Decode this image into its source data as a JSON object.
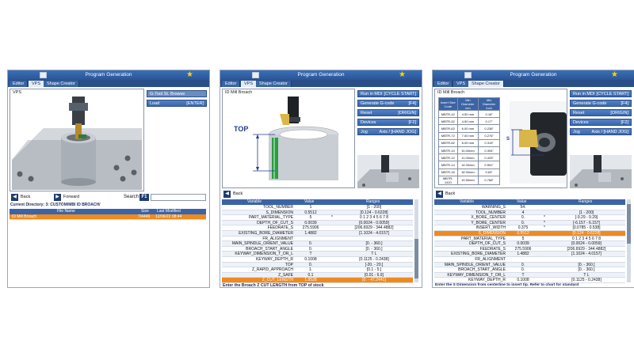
{
  "vps_panel": {
    "title": "Program Generation",
    "tabs": [
      "Editor",
      "VPS",
      "Shape Creator"
    ],
    "group_label": "VPS",
    "side_buttons": [
      {
        "label": "G-Tool St. Browse",
        "key": ""
      },
      {
        "label": "Load",
        "key": "[ENTER]"
      }
    ],
    "back_label": "Back",
    "forward_label": "Forward",
    "search_label": "Search",
    "search_key": "F1",
    "current_directory": "Current Directory: 3: CUSTOM/MBI ID BROACH/",
    "columns": [
      "File Name",
      "Size",
      "Last Modified"
    ],
    "files": [
      {
        "name": "ID Mill Broach",
        "size": "7/4449",
        "modified": "12/06/22 08:44"
      }
    ]
  },
  "broach_panel": {
    "title": "Program Generation",
    "tabs": [
      "Editor",
      "VPS",
      "Shape Creator"
    ],
    "group_label": "ID Mill Broach",
    "diagram_label": "TOP",
    "side_buttons": [
      {
        "label": "Run in MDI",
        "key": "[CYCLE START]"
      },
      {
        "label": "Generate G-code",
        "key": "[F4]"
      },
      {
        "label": "Reset",
        "key": "[ORIGIN]"
      },
      {
        "label": "Devices",
        "key": "[F2]"
      },
      {
        "label": "Jog",
        "key": "Axis / [HAND JOG]"
      }
    ],
    "back_label": "Back",
    "columns": [
      "Variable",
      "Value",
      "Ranges"
    ],
    "rows": [
      {
        "variable": "TOOL_NUMBER",
        "value": "1",
        "range": "[1 - 200]",
        "mark": ""
      },
      {
        "variable": "S_DIMENSION",
        "value": "0.5512",
        "range": "[0.124 - 0.6228]",
        "mark": ""
      },
      {
        "variable": "PART_MATERIAL_TYPE",
        "value": "5",
        "range": "0 1 2 3 4 5 6 7 8",
        "mark": "*"
      },
      {
        "variable": "DEPTH_OF_CUT_S",
        "value": "0.0039",
        "range": "[0.0024 - 0.0059]",
        "mark": ""
      },
      {
        "variable": "FEEDRATE_S",
        "value": "275.5906",
        "range": "[206.6929 - 344.4882]",
        "mark": ""
      },
      {
        "variable": "EXISTING_BORE_DIAMETER",
        "value": "1.4882",
        "range": "[1.1024 - 4.0157]",
        "mark": ""
      },
      {
        "variable": "FR_ALIGNMENT",
        "value": "",
        "range": "",
        "mark": ""
      },
      {
        "variable": "MAIN_SPINDLE_ORIENT_VALUE",
        "value": "0.",
        "range": "[0. - 360.]",
        "mark": ""
      },
      {
        "variable": "BROACH_START_ANGLE",
        "value": "0.",
        "range": "[0. - 360.]",
        "mark": ""
      },
      {
        "variable": "KEYWAY_DIMENSION_T_OR_L",
        "value": "T",
        "range": "T L",
        "mark": ""
      },
      {
        "variable": "KEYWAY_DEPTH_R",
        "value": "0.1008",
        "range": "[0.1125 - 0.2438]",
        "mark": ""
      },
      {
        "variable": "TOP",
        "value": "0.",
        "range": "[-20. - 20.]",
        "mark": ""
      },
      {
        "variable": "Z_RAPID_APPROACH",
        "value": "1.",
        "range": "[0.1 - 5.]",
        "mark": ""
      },
      {
        "variable": "Z_SAFE",
        "value": "0.1",
        "range": "[0.01 - 6.9]",
        "mark": ""
      },
      {
        "variable": "Z_CUT_LENGTH",
        "value": "1.9528",
        "range": "[0. - 47.2441]",
        "mark": ""
      }
    ],
    "status": "Enter the Broach Z CUT LENGTH from TOP of stock"
  },
  "s_panel": {
    "title": "Program Generation",
    "tabs": [
      "Editor",
      "VPS",
      "Shape Creator"
    ],
    "group_label": "ID Mill Broach",
    "diagram_label": "S",
    "chart_headers": [
      "Insert Size Code",
      "Min Diameter mm",
      "Min Diameter inch"
    ],
    "chart_rows": [
      [
        "MBTR-42",
        "4.50 mm",
        "0.18\""
      ],
      [
        "MBTR-52",
        "4.50 mm",
        "0.17\""
      ],
      [
        "MBTR-62",
        "6.00 mm",
        "0.236\""
      ],
      [
        "MBTR-72",
        "7.00 mm",
        "0.276\""
      ],
      [
        "MBTR-82",
        "8.00 mm",
        "0.315\""
      ],
      [
        "MBTR-10",
        "10.00mm",
        "0.394\""
      ],
      [
        "MBTR-12",
        "11.00mm",
        "0.433\""
      ],
      [
        "MBTR-14",
        "14.00mm",
        "0.551\""
      ],
      [
        "MBTR-16",
        "16.00mm",
        "0.63\""
      ],
      [
        "MBTR-1410",
        "19.50mm",
        "0.768\""
      ]
    ],
    "side_buttons": [
      {
        "label": "Run in MDI",
        "key": "[CYCLE START]"
      },
      {
        "label": "Generate G-code",
        "key": "[F4]"
      },
      {
        "label": "Reset",
        "key": "[ORIGIN]"
      },
      {
        "label": "Devices",
        "key": "[F2]"
      },
      {
        "label": "Jog",
        "key": "Axis / [HAND JOG]"
      }
    ],
    "back_label": "Back",
    "columns": [
      "Variable",
      "Value",
      "Ranges"
    ],
    "rows": [
      {
        "variable": "WARNING_S",
        "value": "54.",
        "range": "",
        "mark": ""
      },
      {
        "variable": "TOOL_NUMBER",
        "value": "4",
        "range": "[1 - 200]",
        "mark": ""
      },
      {
        "variable": "X_BORE_CENTER",
        "value": "0.",
        "range": "[-9.29 - 9.29]",
        "mark": "*"
      },
      {
        "variable": "Y_BORE_CENTER",
        "value": "0.",
        "range": "[-6.157 - 6.157]",
        "mark": "*"
      },
      {
        "variable": "INSERT_WIDTH",
        "value": "0.375",
        "range": "[0.0785 - 0.538]",
        "mark": "*"
      },
      {
        "variable": "S_DIMENSION",
        "value": "0.5512",
        "range": "[0.124 - 0.6228]",
        "mark": ""
      },
      {
        "variable": "PART_MATERIAL_TYPE",
        "value": "5",
        "range": "0 1 2 3 4 5 6 7 8",
        "mark": ""
      },
      {
        "variable": "DEPTH_OF_CUT_S",
        "value": "0.0039",
        "range": "[0.0024 - 0.0059]",
        "mark": ""
      },
      {
        "variable": "FEEDRATE_S",
        "value": "275.5906",
        "range": "[206.6929 - 344.4882]",
        "mark": ""
      },
      {
        "variable": "EXISTING_BORE_DIAMETER",
        "value": "1.4882",
        "range": "[1.1024 - 4.0157]",
        "mark": ""
      },
      {
        "variable": "FR_ALIGNMENT",
        "value": "",
        "range": "",
        "mark": ""
      },
      {
        "variable": "MAIN_SPINDLE_ORIENT_VALUE",
        "value": "0.",
        "range": "[0. - 360.]",
        "mark": ""
      },
      {
        "variable": "BROACH_START_ANGLE",
        "value": "0.",
        "range": "[0. - 360.]",
        "mark": ""
      },
      {
        "variable": "KEYWAY_DIMENSION_T_OR_L",
        "value": "T",
        "range": "T L",
        "mark": ""
      },
      {
        "variable": "KEYWAY_DEPTH_R",
        "value": "0.1008",
        "range": "[0.1125 - 0.2438]",
        "mark": ""
      }
    ],
    "selected_row": 5,
    "status": "Enter the S Dimension from centerline to insert tip. Refer to chart for standard"
  },
  "colors": {
    "title_blue": "#2a5595",
    "tab_dark": "#2a4f88",
    "button_blue": "#4a78be",
    "selected_orange": "#ef8a1f",
    "status_navy": "#1a2a5a",
    "star_yellow": "#ffd400"
  }
}
